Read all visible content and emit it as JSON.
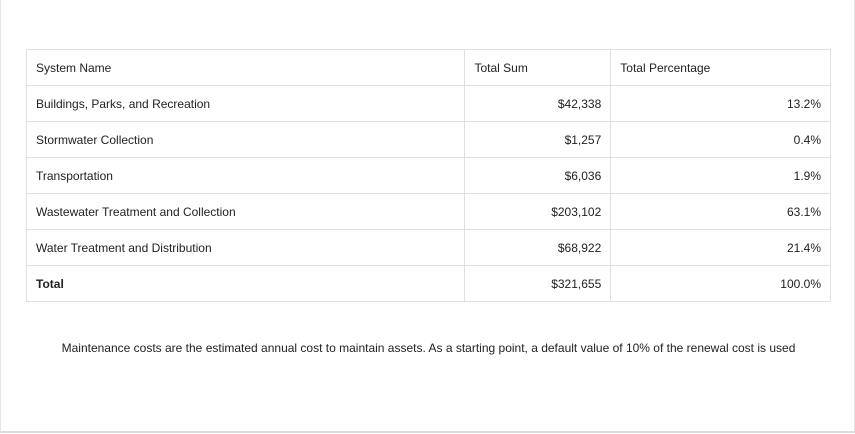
{
  "table": {
    "headers": [
      "System Name",
      "Total Sum",
      "Total Percentage"
    ],
    "rows": [
      {
        "name": "Buildings, Parks, and Recreation",
        "sum": "$42,338",
        "pct": "13.2%"
      },
      {
        "name": "Stormwater Collection",
        "sum": "$1,257",
        "pct": "0.4%"
      },
      {
        "name": "Transportation",
        "sum": "$6,036",
        "pct": "1.9%"
      },
      {
        "name": "Wastewater Treatment and Collection",
        "sum": "$203,102",
        "pct": "63.1%"
      },
      {
        "name": "Water Treatment and Distribution",
        "sum": "$68,922",
        "pct": "21.4%"
      }
    ],
    "total": {
      "name": "Total",
      "sum": "$321,655",
      "pct": "100.0%"
    }
  },
  "note": "Maintenance costs are the estimated annual cost to maintain assets. As a starting point, a default value of 10% of the renewal cost is used"
}
